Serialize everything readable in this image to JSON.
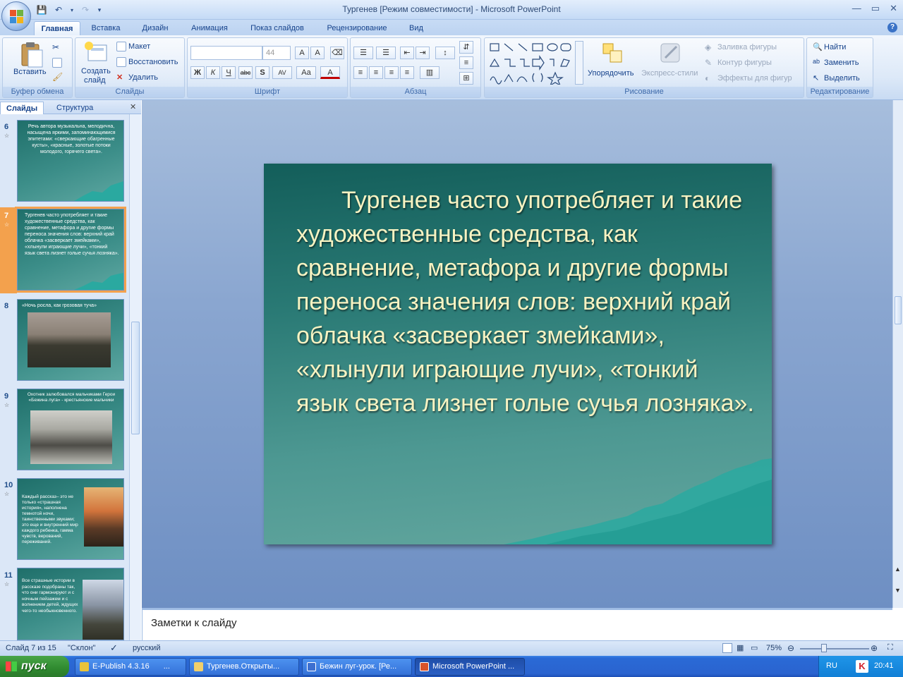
{
  "window": {
    "title": "Тургенев [Режим совместимости] - Microsoft PowerPoint"
  },
  "ribbon_tabs": [
    "Главная",
    "Вставка",
    "Дизайн",
    "Анимация",
    "Показ слайдов",
    "Рецензирование",
    "Вид"
  ],
  "groups": {
    "clipboard": {
      "label": "Буфер обмена",
      "paste": "Вставить"
    },
    "slides": {
      "label": "Слайды",
      "new_slide_1": "Создать",
      "new_slide_2": "слайд",
      "layout": "Макет",
      "reset": "Восстановить",
      "delete": "Удалить"
    },
    "font": {
      "label": "Шрифт",
      "font_size": "44"
    },
    "paragraph": {
      "label": "Абзац"
    },
    "drawing": {
      "label": "Рисование",
      "arrange": "Упорядочить",
      "quick_styles": "Экспресс-стили",
      "fill": "Заливка фигуры",
      "outline": "Контур фигуры",
      "effects": "Эффекты для фигур"
    },
    "editing": {
      "label": "Редактирование",
      "find": "Найти",
      "replace": "Заменить",
      "select": "Выделить"
    }
  },
  "pane_tabs": [
    "Слайды",
    "Структура"
  ],
  "thumbnails": [
    {
      "num": "6",
      "text": "Речь автора музыкальна, мелодична, насыщена яркими, запоминающимися эпитетами: «сверкающие обагренные кусты», «красные, золотые потоки молодого, горячего света»."
    },
    {
      "num": "7",
      "text": "Тургенев часто употребляет и такие художественные средства, как сравнение, метафора и другие формы переноса значения слов: верхний край облачка «засверкает змейками», «хлынули играющие лучи», «тонкий язык света лизнет голые сучья лозняка»."
    },
    {
      "num": "8",
      "text": "«Ночь росла, как грозовая туча»"
    },
    {
      "num": "9",
      "text": "Охотник залюбовался мальчиками Герои «Бежина луга» - крестьянские мальчики"
    },
    {
      "num": "10",
      "text": "Каждый рассказ– это не только «страшная история», наполнена темнотой ночи, таинственными звуками; это еще и внутренний мир каждого ребенка, гамма чувств, верований, переживаний."
    },
    {
      "num": "11",
      "text": "Все страшные истории в рассказе подобраны так, что они гармонируют и с ночным пейзажем и с волнением детей, ждущих чего-то необыкновенного."
    }
  ],
  "slide": {
    "text": "Тургенев часто употребляет и такие художественные средства, как сравнение, метафора и другие формы переноса значения слов: верхний край облачка «засверкает змейками», «хлынули играющие лучи», «тонкий язык света лизнет голые сучья лозняка»."
  },
  "notes": {
    "placeholder": "Заметки к слайду"
  },
  "status": {
    "slide_info": "Слайд 7 из 15",
    "theme": "\"Склон\"",
    "language": "русский",
    "zoom": "75%"
  },
  "taskbar": {
    "start": "пуск",
    "tasks": [
      "E-Publish 4.3.16",
      "...",
      "Тургенев.Открыты...",
      "Бежин луг-урок. [Ре...",
      "Microsoft PowerPoint ..."
    ],
    "lang": "RU",
    "clock": "20:41"
  },
  "colors": {
    "slide_bg": "#2a7a75",
    "slide_text": "#f7f3c2",
    "selection": "#f3a14d",
    "ribbon": "#dde9f8",
    "taskbar": "#2a63cf"
  }
}
